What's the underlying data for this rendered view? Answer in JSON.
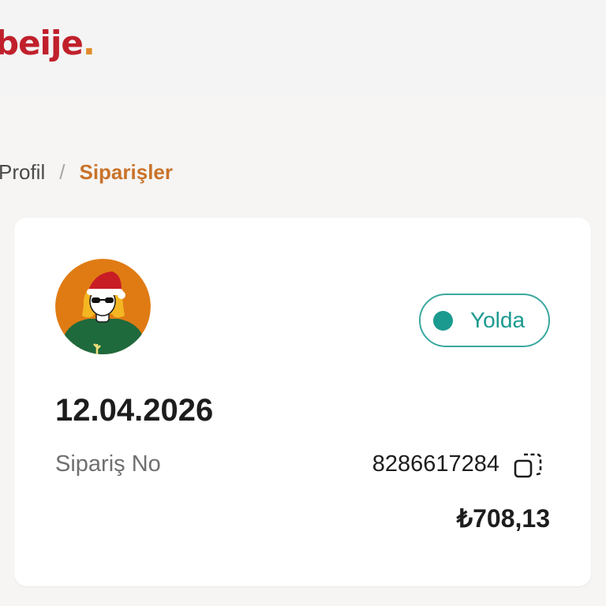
{
  "header": {
    "logo_text": "beije",
    "logo_dot": ".",
    "colors": {
      "brand": "#c0202c",
      "accent": "#e08a2a"
    }
  },
  "breadcrumb": {
    "items": [
      "Profil",
      "Siparişler"
    ],
    "separator": "/"
  },
  "order": {
    "avatar_icon": "avatar-santa-hat-sunglasses",
    "status": {
      "label": "Yolda",
      "color": "#1b9a8f"
    },
    "date": "12.04.2026",
    "number_label": "Sipariş No",
    "number_value": "8286617284",
    "copy_icon": "copy-icon",
    "total": "₺708,13"
  }
}
